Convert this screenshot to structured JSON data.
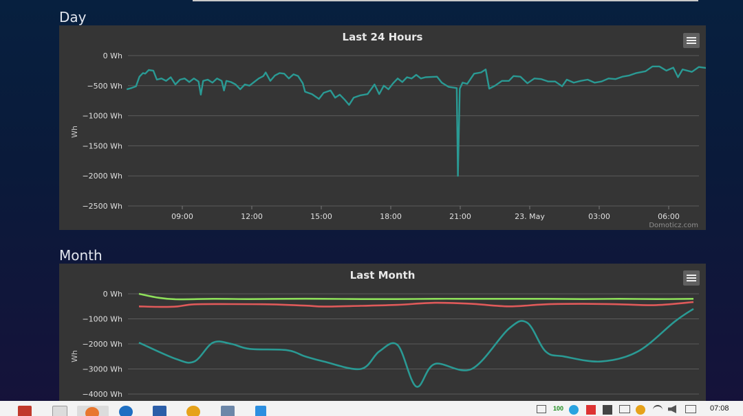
{
  "sections": {
    "day": {
      "title": "Day"
    },
    "month": {
      "title": "Month"
    }
  },
  "day_chart": {
    "title": "Last 24 Hours",
    "y_axis_label": "Wh",
    "y_ticks": [
      "0 Wh",
      "−500 Wh",
      "−1000 Wh",
      "−1500 Wh",
      "−2000 Wh",
      "−2500 Wh"
    ],
    "x_ticks": [
      "09:00",
      "12:00",
      "15:00",
      "18:00",
      "21:00",
      "23. May",
      "03:00",
      "06:00"
    ],
    "credit": "Domoticz.com",
    "line_color": "#2a9a94"
  },
  "month_chart": {
    "title": "Last Month",
    "y_axis_label": "Wh",
    "y_ticks": [
      "0 Wh",
      "−1000 Wh",
      "−2000 Wh",
      "−3000 Wh",
      "−4000 Wh"
    ],
    "colors": [
      "#8ee05a",
      "#e05a5a",
      "#2a9a94"
    ]
  },
  "chart_data": [
    {
      "type": "line",
      "title": "Last 24 Hours",
      "ylabel": "Wh",
      "ylim": [
        -2500,
        0
      ],
      "grid": true,
      "legend": "none",
      "x_unit": "hours from 09:00 (axis labels: 09:00 … 23. May … 06:00)",
      "series": [
        {
          "color": "#2a9a94",
          "points": [
            [
              -2.4,
              -560
            ],
            [
              -2.2,
              -540
            ],
            [
              -2.0,
              -510
            ],
            [
              -1.85,
              -350
            ],
            [
              -1.7,
              -290
            ],
            [
              -1.6,
              -300
            ],
            [
              -1.45,
              -240
            ],
            [
              -1.25,
              -250
            ],
            [
              -1.1,
              -400
            ],
            [
              -0.9,
              -380
            ],
            [
              -0.7,
              -420
            ],
            [
              -0.5,
              -360
            ],
            [
              -0.3,
              -480
            ],
            [
              -0.1,
              -400
            ],
            [
              0.1,
              -380
            ],
            [
              0.3,
              -440
            ],
            [
              0.5,
              -380
            ],
            [
              0.7,
              -430
            ],
            [
              0.8,
              -650
            ],
            [
              0.9,
              -420
            ],
            [
              1.1,
              -400
            ],
            [
              1.3,
              -450
            ],
            [
              1.5,
              -380
            ],
            [
              1.7,
              -420
            ],
            [
              1.8,
              -580
            ],
            [
              1.9,
              -420
            ],
            [
              2.1,
              -440
            ],
            [
              2.3,
              -480
            ],
            [
              2.5,
              -560
            ],
            [
              2.7,
              -480
            ],
            [
              2.9,
              -500
            ],
            [
              3.1,
              -440
            ],
            [
              3.3,
              -380
            ],
            [
              3.5,
              -340
            ],
            [
              3.6,
              -280
            ],
            [
              3.8,
              -420
            ],
            [
              4.0,
              -330
            ],
            [
              4.2,
              -290
            ],
            [
              4.4,
              -300
            ],
            [
              4.6,
              -380
            ],
            [
              4.8,
              -310
            ],
            [
              5.0,
              -340
            ],
            [
              5.2,
              -460
            ],
            [
              5.3,
              -600
            ],
            [
              5.6,
              -640
            ],
            [
              5.9,
              -720
            ],
            [
              6.1,
              -620
            ],
            [
              6.4,
              -580
            ],
            [
              6.6,
              -700
            ],
            [
              6.8,
              -650
            ],
            [
              7.0,
              -730
            ],
            [
              7.2,
              -820
            ],
            [
              7.4,
              -700
            ],
            [
              7.7,
              -660
            ],
            [
              8.0,
              -640
            ],
            [
              8.3,
              -480
            ],
            [
              8.5,
              -640
            ],
            [
              8.7,
              -500
            ],
            [
              8.9,
              -560
            ],
            [
              9.1,
              -460
            ],
            [
              9.3,
              -380
            ],
            [
              9.5,
              -440
            ],
            [
              9.7,
              -360
            ],
            [
              9.9,
              -380
            ],
            [
              10.1,
              -320
            ],
            [
              10.3,
              -380
            ],
            [
              10.5,
              -360
            ],
            [
              11.0,
              -350
            ],
            [
              11.2,
              -450
            ],
            [
              11.5,
              -520
            ],
            [
              11.85,
              -540
            ],
            [
              11.9,
              -2000
            ],
            [
              11.98,
              -550
            ],
            [
              12.1,
              -450
            ],
            [
              12.3,
              -470
            ],
            [
              12.6,
              -300
            ],
            [
              12.9,
              -280
            ],
            [
              13.1,
              -230
            ],
            [
              13.25,
              -550
            ],
            [
              13.5,
              -500
            ],
            [
              13.8,
              -420
            ],
            [
              14.1,
              -420
            ],
            [
              14.3,
              -340
            ],
            [
              14.6,
              -350
            ],
            [
              14.9,
              -460
            ],
            [
              15.2,
              -380
            ],
            [
              15.5,
              -390
            ],
            [
              15.8,
              -430
            ],
            [
              16.1,
              -430
            ],
            [
              16.4,
              -510
            ],
            [
              16.6,
              -400
            ],
            [
              16.9,
              -450
            ],
            [
              17.2,
              -420
            ],
            [
              17.5,
              -400
            ],
            [
              17.8,
              -450
            ],
            [
              18.1,
              -430
            ],
            [
              18.4,
              -380
            ],
            [
              18.7,
              -390
            ],
            [
              19.0,
              -350
            ],
            [
              19.3,
              -330
            ],
            [
              19.6,
              -290
            ],
            [
              20.0,
              -260
            ],
            [
              20.3,
              -180
            ],
            [
              20.6,
              -180
            ],
            [
              20.9,
              -250
            ],
            [
              21.2,
              -200
            ],
            [
              21.4,
              -360
            ],
            [
              21.6,
              -230
            ],
            [
              22.0,
              -270
            ],
            [
              22.3,
              -190
            ],
            [
              22.7,
              -210
            ],
            [
              22.9,
              -300
            ],
            [
              23.1,
              -220
            ],
            [
              23.4,
              -220
            ],
            [
              23.6,
              -350
            ],
            [
              23.8,
              -420
            ],
            [
              23.85,
              -400
            ]
          ]
        }
      ]
    },
    {
      "type": "line",
      "title": "Last Month",
      "ylabel": "Wh",
      "ylim": [
        -4400,
        0
      ],
      "grid": true,
      "legend": "none",
      "x_unit": "day index (no x-axis labels visible)",
      "series": [
        {
          "color": "#8ee05a",
          "points": [
            [
              0,
              0
            ],
            [
              1,
              -150
            ],
            [
              2,
              -220
            ],
            [
              4,
              -200
            ],
            [
              6,
              -210
            ],
            [
              8,
              -200
            ],
            [
              10,
              -200
            ],
            [
              12,
              -210
            ],
            [
              14,
              -210
            ],
            [
              16,
              -200
            ],
            [
              18,
              -200
            ],
            [
              20,
              -200
            ],
            [
              22,
              -200
            ],
            [
              24,
              -210
            ],
            [
              26,
              -200
            ],
            [
              28,
              -210
            ],
            [
              30,
              -200
            ]
          ]
        },
        {
          "color": "#e05a5a",
          "points": [
            [
              0,
              -500
            ],
            [
              1,
              -520
            ],
            [
              2,
              -510
            ],
            [
              3,
              -420
            ],
            [
              5,
              -410
            ],
            [
              7,
              -420
            ],
            [
              9,
              -470
            ],
            [
              10,
              -510
            ],
            [
              12,
              -480
            ],
            [
              14,
              -440
            ],
            [
              16,
              -360
            ],
            [
              18,
              -400
            ],
            [
              20,
              -500
            ],
            [
              22,
              -420
            ],
            [
              24,
              -400
            ],
            [
              26,
              -420
            ],
            [
              28,
              -450
            ],
            [
              30,
              -330
            ]
          ]
        },
        {
          "color": "#2a9a94",
          "points": [
            [
              0,
              -1950
            ],
            [
              2,
              -2600
            ],
            [
              3,
              -2700
            ],
            [
              4,
              -1950
            ],
            [
              5,
              -2000
            ],
            [
              6,
              -2200
            ],
            [
              8,
              -2250
            ],
            [
              9,
              -2500
            ],
            [
              10,
              -2700
            ],
            [
              12,
              -3000
            ],
            [
              13,
              -2300
            ],
            [
              14,
              -2050
            ],
            [
              15,
              -3700
            ],
            [
              16,
              -2800
            ],
            [
              18,
              -3000
            ],
            [
              20,
              -1400
            ],
            [
              21,
              -1150
            ],
            [
              22,
              -2300
            ],
            [
              23,
              -2500
            ],
            [
              25,
              -2700
            ],
            [
              27,
              -2300
            ],
            [
              29,
              -1100
            ],
            [
              30,
              -600
            ]
          ]
        }
      ]
    }
  ]
}
